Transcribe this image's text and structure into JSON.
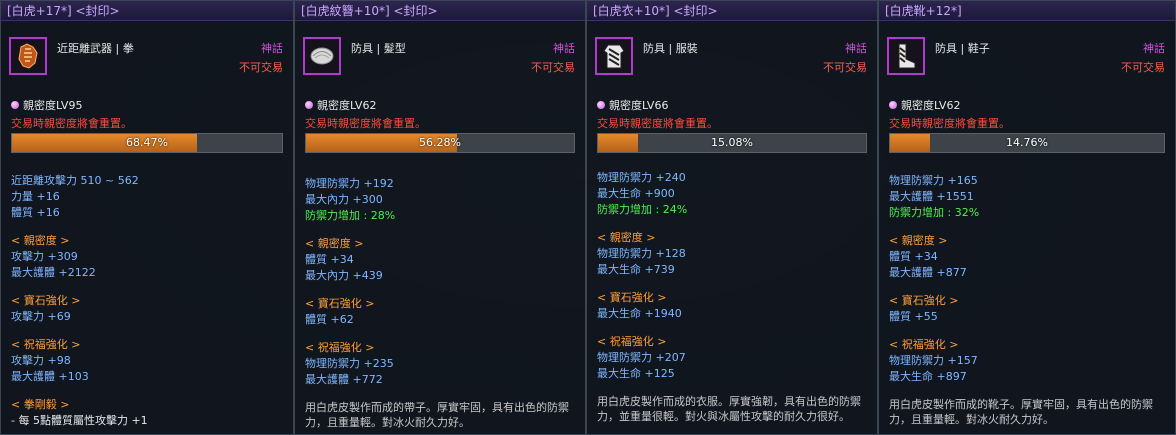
{
  "colors": {
    "title": "#c9a6ff",
    "grade": "#cc55dd",
    "untradeable": "#ff5a4a",
    "stat": "#7fb7ff",
    "bonus": "#4ef04e",
    "section": "#ff9f3a",
    "bar_fill": "#e58a2c"
  },
  "tooltips": [
    {
      "title": "[白虎+17*] <封印>",
      "icon": "fist-weapon-icon",
      "type": "近距離武器 | 拳",
      "grade": "神話",
      "trade": "不可交易",
      "intimacy": "親密度LV95",
      "reset_note": "交易時親密度將會重置。",
      "progress_text": "68.47%",
      "progress": 0.6847,
      "base_stats": [
        "近距離攻擊力 510 ~ 562",
        "力量 +16",
        "體質 +16"
      ],
      "base_bonus": "",
      "sections": [
        {
          "header": "< 親密度 >",
          "lines": [
            "攻擊力 +309",
            "最大護體 +2122"
          ]
        },
        {
          "header": "< 寶石強化 >",
          "lines": [
            "攻擊力 +69"
          ]
        },
        {
          "header": "< 祝福強化 >",
          "lines": [
            "攻擊力 +98",
            "最大護體 +103"
          ]
        },
        {
          "header": "< 拳剛毅 >",
          "lines": [
            "- 每 5點體質屬性攻擊力 +1"
          ]
        }
      ],
      "description": ""
    },
    {
      "title": "[白虎紋簪+10*] <封印>",
      "icon": "hairpiece-icon",
      "type": "防具 | 髮型",
      "grade": "神話",
      "trade": "不可交易",
      "intimacy": "親密度LV62",
      "reset_note": "交易時親密度將會重置。",
      "progress_text": "56.28%",
      "progress": 0.5628,
      "base_stats": [
        "物理防禦力 +192",
        "最大內力 +300"
      ],
      "base_bonus": "防禦力增加 : 28%",
      "sections": [
        {
          "header": "< 親密度 >",
          "lines": [
            "體質 +34",
            "最大內力 +439"
          ]
        },
        {
          "header": "< 寶石強化 >",
          "lines": [
            "體質 +62"
          ]
        },
        {
          "header": "< 祝福強化 >",
          "lines": [
            "物理防禦力 +235",
            "最大護體 +772"
          ]
        }
      ],
      "description": "用白虎皮製作而成的帶子。厚實牢固，具有出色的防禦力，且重量輕。對冰火耐久力好。"
    },
    {
      "title": "[白虎衣+10*] <封印>",
      "icon": "robe-armor-icon",
      "type": "防具 | 服裝",
      "grade": "神話",
      "trade": "不可交易",
      "intimacy": "親密度LV66",
      "reset_note": "交易時親密度將會重置。",
      "progress_text": "15.08%",
      "progress": 0.1508,
      "base_stats": [
        "物理防禦力 +240",
        "最大生命 +900"
      ],
      "base_bonus": "防禦力增加 : 24%",
      "sections": [
        {
          "header": "< 親密度 >",
          "lines": [
            "物理防禦力 +128",
            "最大生命 +739"
          ]
        },
        {
          "header": "< 寶石強化 >",
          "lines": [
            "最大生命 +1940"
          ]
        },
        {
          "header": "< 祝福強化 >",
          "lines": [
            "物理防禦力 +207",
            "最大生命 +125"
          ]
        }
      ],
      "description": "用白虎皮製作而成的衣服。厚實強韌，具有出色的防禦力，並重量很輕。對火與冰屬性攻擊的耐久力很好。"
    },
    {
      "title": "[白虎靴+12*]",
      "icon": "boots-icon",
      "type": "防具 | 鞋子",
      "grade": "神話",
      "trade": "不可交易",
      "intimacy": "親密度LV62",
      "reset_note": "交易時親密度將會重置。",
      "progress_text": "14.76%",
      "progress": 0.1476,
      "base_stats": [
        "物理防禦力 +165",
        "最大護體 +1551"
      ],
      "base_bonus": "防禦力增加 : 32%",
      "sections": [
        {
          "header": "< 親密度 >",
          "lines": [
            "體質 +34",
            "最大護體 +877"
          ]
        },
        {
          "header": "< 寶石強化 >",
          "lines": [
            "體質 +55"
          ]
        },
        {
          "header": "< 祝福強化 >",
          "lines": [
            "物理防禦力 +157",
            "最大生命 +897"
          ]
        }
      ],
      "description": "用白虎皮製作而成的靴子。厚實牢固，具有出色的防禦力，且重量輕。對冰火耐久力好。"
    }
  ]
}
